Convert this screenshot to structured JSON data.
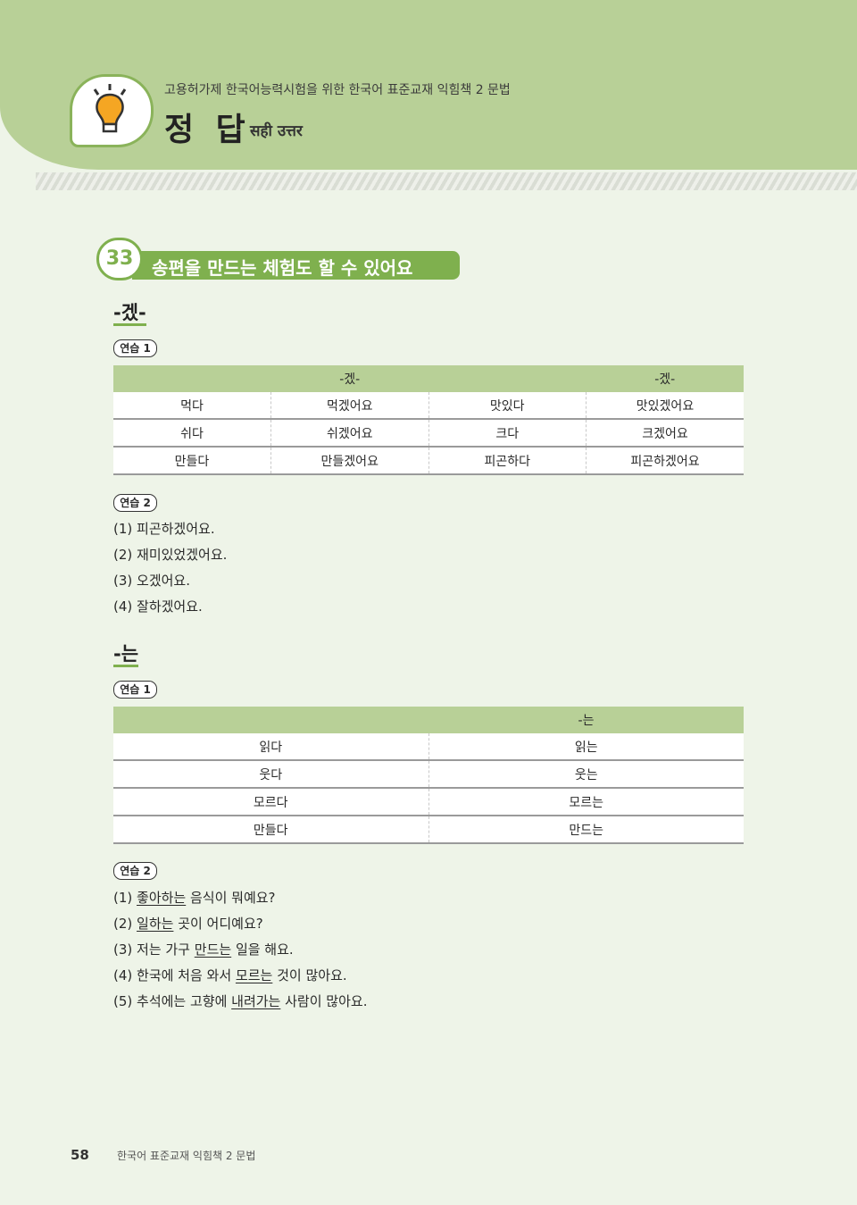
{
  "header": {
    "subtitle": "고용허가제 한국어능력시험을 위한 한국어 표준교재 익힘책 2  문법",
    "title": "정 답",
    "title_hindi": "सही उत्तर",
    "bulb_icon": "lightbulb-icon"
  },
  "lesson": {
    "number": "33",
    "title": "송편을 만드는 체험도 할 수 있어요"
  },
  "section1": {
    "grammar": "-겠-",
    "ex1_tag": "연습 1",
    "table": {
      "headers": [
        "",
        "-겠-",
        "",
        "-겠-"
      ],
      "rows": [
        [
          "먹다",
          "먹겠어요",
          "맛있다",
          "맛있겠어요"
        ],
        [
          "쉬다",
          "쉬겠어요",
          "크다",
          "크겠어요"
        ],
        [
          "만들다",
          "만들겠어요",
          "피곤하다",
          "피곤하겠어요"
        ]
      ]
    },
    "ex2_tag": "연습 2",
    "answers": [
      "(1) 피곤하겠어요.",
      "(2) 재미있었겠어요.",
      "(3) 오겠어요.",
      "(4) 잘하겠어요."
    ]
  },
  "section2": {
    "grammar": "-는",
    "ex1_tag": "연습 1",
    "table": {
      "headers": [
        "",
        "-는"
      ],
      "rows": [
        [
          "읽다",
          "읽는"
        ],
        [
          "웃다",
          "웃는"
        ],
        [
          "모르다",
          "모르는"
        ],
        [
          "만들다",
          "만드는"
        ]
      ]
    },
    "ex2_tag": "연습 2",
    "answers": [
      {
        "pre": "(1) ",
        "u": "좋아하는",
        "post": " 음식이 뭐예요?"
      },
      {
        "pre": "(2) ",
        "u": "일하는",
        "post": " 곳이 어디예요?"
      },
      {
        "pre": "(3) 저는 가구 ",
        "u": "만드는",
        "post": " 일을 해요."
      },
      {
        "pre": "(4) 한국에 처음 와서 ",
        "u": "모르는",
        "post": " 것이 많아요."
      },
      {
        "pre": "(5) 추석에는 고향에 ",
        "u": "내려가는",
        "post": " 사람이 많아요."
      }
    ]
  },
  "footer": {
    "page_number": "58",
    "book": "한국어 표준교재 익힘책 2  문법"
  }
}
